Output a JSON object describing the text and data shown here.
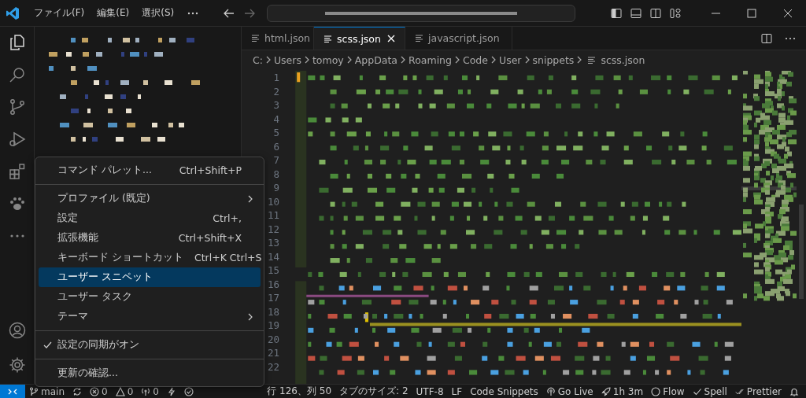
{
  "title_bar": {
    "menus": [
      "ファイル(F)",
      "編集(E)",
      "選択(S)"
    ]
  },
  "tabs": [
    {
      "label": "html.json",
      "selected": false
    },
    {
      "label": "scss.json",
      "selected": true
    },
    {
      "label": "javascript.json",
      "selected": false
    }
  ],
  "breadcrumb": [
    "C:",
    "Users",
    "tomoy",
    "AppData",
    "Roaming",
    "Code",
    "User",
    "snippets",
    "scss.json"
  ],
  "line_numbers": [
    "1",
    "2",
    "3",
    "4",
    "5",
    "6",
    "7",
    "8",
    "9",
    "10",
    "11",
    "12",
    "13",
    "14",
    "15",
    "16",
    "17",
    "18",
    "19",
    "20",
    "21",
    "22"
  ],
  "menu": [
    {
      "kind": "item",
      "label": "コマンド パレット...",
      "shortcut": "Ctrl+Shift+P",
      "selected": false,
      "checked": false,
      "submenu": false
    },
    {
      "kind": "separator"
    },
    {
      "kind": "item",
      "label": "プロファイル (既定)",
      "selected": false,
      "checked": false,
      "submenu": true
    },
    {
      "kind": "item",
      "label": "設定",
      "shortcut": "Ctrl+,",
      "selected": false,
      "checked": false,
      "submenu": false
    },
    {
      "kind": "item",
      "label": "拡張機能",
      "shortcut": "Ctrl+Shift+X",
      "selected": false,
      "checked": false,
      "submenu": false
    },
    {
      "kind": "item",
      "label": "キーボード ショートカット",
      "shortcut": "Ctrl+K Ctrl+S",
      "selected": false,
      "checked": false,
      "submenu": false
    },
    {
      "kind": "item",
      "label": "ユーザー スニペット",
      "selected": true,
      "checked": false,
      "submenu": false
    },
    {
      "kind": "item",
      "label": "ユーザー タスク",
      "selected": false,
      "checked": false,
      "submenu": false
    },
    {
      "kind": "item",
      "label": "テーマ",
      "selected": false,
      "checked": false,
      "submenu": true
    },
    {
      "kind": "separator"
    },
    {
      "kind": "item",
      "label": "設定の同期がオン",
      "selected": false,
      "checked": true,
      "submenu": false
    },
    {
      "kind": "separator"
    },
    {
      "kind": "item",
      "label": "更新の確認...",
      "selected": false,
      "checked": false,
      "submenu": false
    }
  ],
  "status_bar": {
    "left": [
      {
        "kind": "branch",
        "text": "main"
      },
      {
        "kind": "sync"
      },
      {
        "kind": "error",
        "text": "0"
      },
      {
        "kind": "warning",
        "text": "0"
      },
      {
        "kind": "ports",
        "text": "0"
      },
      {
        "kind": "bolt"
      },
      {
        "kind": "check"
      }
    ],
    "right": [
      {
        "kind": "text",
        "text": "行 126、列 50"
      },
      {
        "kind": "text",
        "text": "タブのサイズ: 2"
      },
      {
        "kind": "text",
        "text": "UTF-8"
      },
      {
        "kind": "text",
        "text": "LF"
      },
      {
        "kind": "text",
        "text": "Code Snippets"
      },
      {
        "kind": "broadcast",
        "text": "Go Live"
      },
      {
        "kind": "rocket",
        "text": "1h 3m"
      },
      {
        "kind": "circle",
        "text": "Flow"
      },
      {
        "kind": "tick",
        "text": "Spell"
      },
      {
        "kind": "double-tick",
        "text": "Prettier"
      },
      {
        "kind": "bell"
      }
    ]
  }
}
